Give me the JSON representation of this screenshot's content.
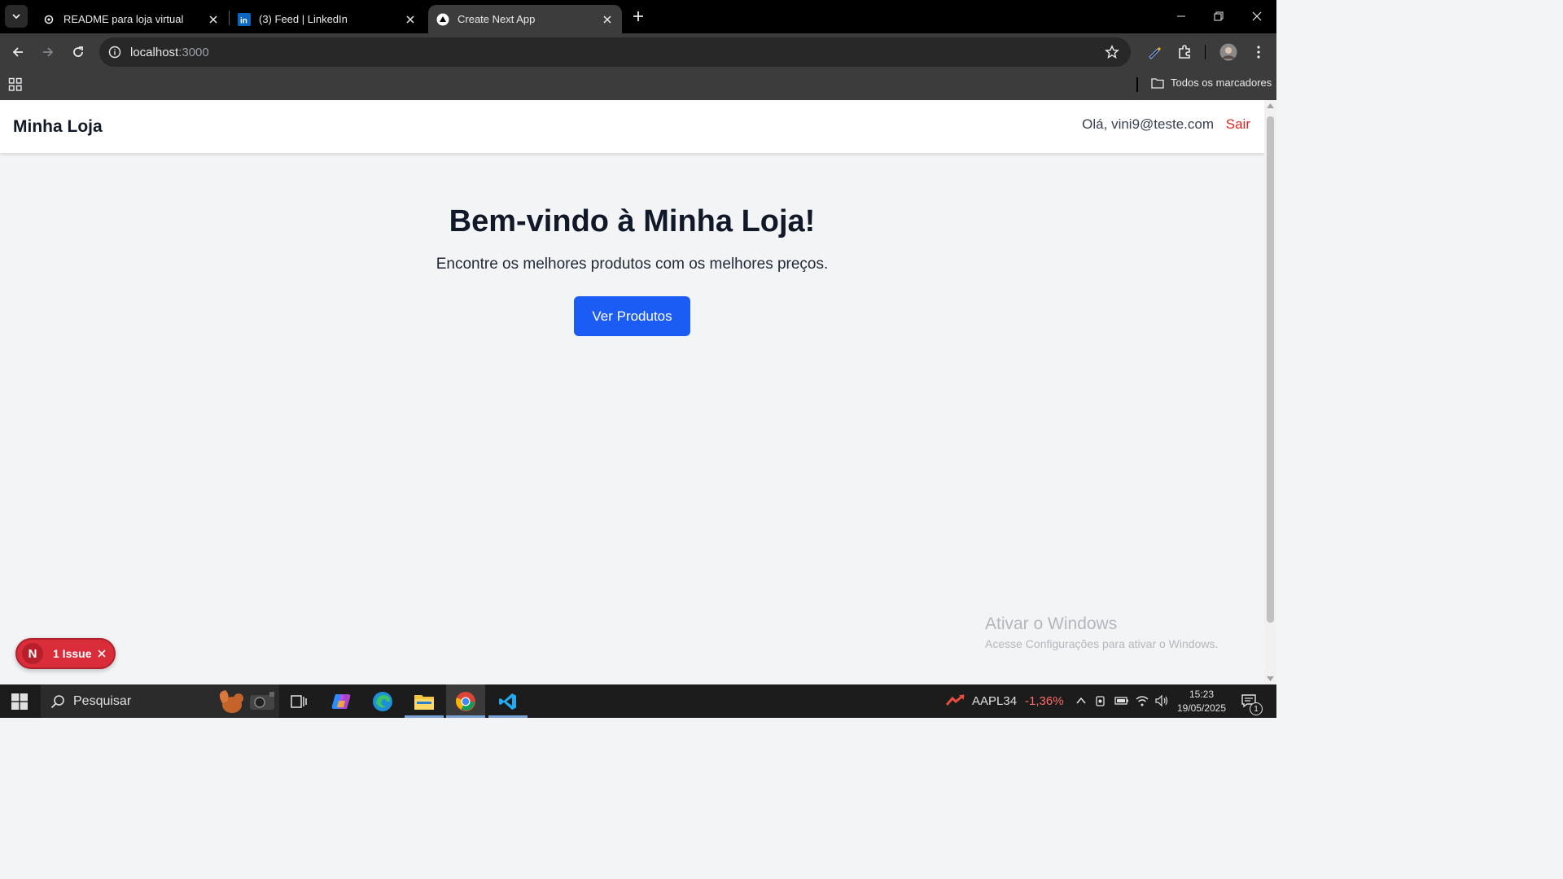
{
  "browser": {
    "tabs": [
      {
        "title": "README para loja virtual",
        "active": false
      },
      {
        "title": "(3) Feed | LinkedIn",
        "active": false
      },
      {
        "title": "Create Next App",
        "active": true
      }
    ],
    "url_host": "localhost",
    "url_port": ":3000",
    "bookmarks_all_label": "Todos os marcadores"
  },
  "site": {
    "brand": "Minha Loja",
    "greeting": "Olá, vini9@teste.com",
    "logout_label": "Sair",
    "hero_title": "Bem-vindo à Minha Loja!",
    "hero_subtitle": "Encontre os melhores produtos com os melhores preços.",
    "cta_label": "Ver Produtos",
    "cta_color": "#1b5cf5",
    "logout_color": "#dc2626"
  },
  "dev_overlay": {
    "badge_letter": "N",
    "issue_label": "1 Issue"
  },
  "watermark": {
    "line1": "Ativar o Windows",
    "line2": "Acesse Configurações para ativar o Windows."
  },
  "taskbar": {
    "search_placeholder": "Pesquisar",
    "ticker_symbol": "AAPL34",
    "ticker_change": "-1,36%",
    "time": "15:23",
    "date": "19/05/2025",
    "notification_count": "1"
  }
}
